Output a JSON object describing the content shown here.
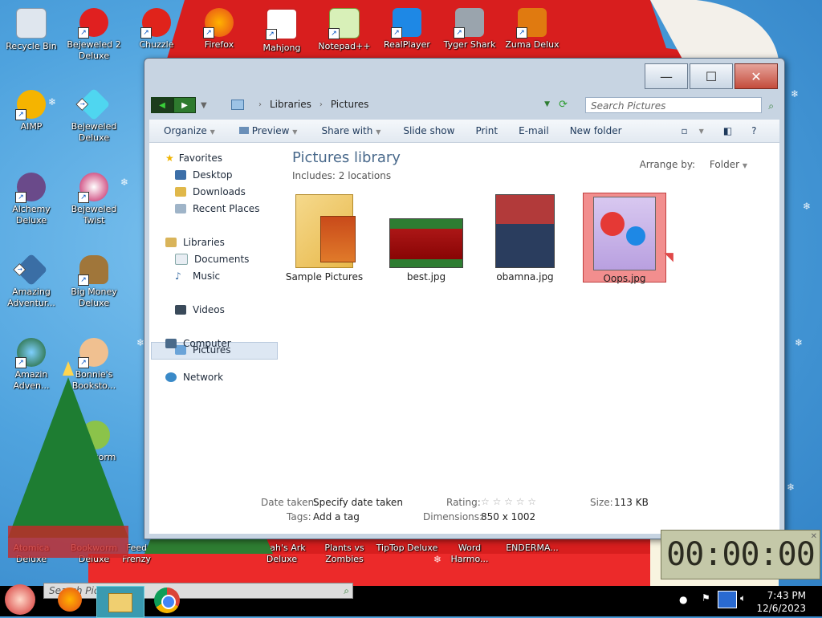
{
  "desktop_icons": [
    {
      "label": "Recycle Bin"
    },
    {
      "label": "Bejeweled 2 Deluxe"
    },
    {
      "label": "Chuzzle"
    },
    {
      "label": "Firefox"
    },
    {
      "label": "Mahjong"
    },
    {
      "label": "Notepad++"
    },
    {
      "label": "RealPlayer"
    },
    {
      "label": "Tyger Shark"
    },
    {
      "label": "Zuma Delux"
    },
    {
      "label": "AIMP"
    },
    {
      "label": "Bejeweled Deluxe"
    },
    {
      "label": "Alchemy Deluxe"
    },
    {
      "label": "Bejeweled Twist"
    },
    {
      "label": "Amazing Adventur..."
    },
    {
      "label": "Big Money Deluxe"
    },
    {
      "label": "Amazin Adven..."
    },
    {
      "label": "Bonnie's Booksto..."
    },
    {
      "label": "worm"
    },
    {
      "label": "Atomica Deluxe"
    },
    {
      "label": "Bookworm Deluxe"
    },
    {
      "label": "Feed Frenzy"
    },
    {
      "label": "ong"
    },
    {
      "label": "Noah's Ark Deluxe"
    },
    {
      "label": "Plants vs Zombies"
    },
    {
      "label": "TipTop Deluxe"
    },
    {
      "label": "Word Harmo..."
    },
    {
      "label": "ENDERMA..."
    }
  ],
  "window": {
    "breadcrumb": [
      "Libraries",
      "Pictures"
    ],
    "search_placeholder": "Search Pictures",
    "toolbar": [
      "Organize",
      "Preview",
      "Share with",
      "Slide show",
      "Print",
      "E-mail",
      "New folder"
    ],
    "nav": {
      "favorites_header": "Favorites",
      "favorites": [
        "Desktop",
        "Downloads",
        "Recent Places"
      ],
      "libraries_header": "Libraries",
      "libraries": [
        "Documents",
        "Music",
        "Pictures",
        "Videos"
      ],
      "computer": "Computer",
      "network": "Network"
    },
    "library_title": "Pictures library",
    "library_subtitle": "Includes:  2 locations",
    "arrange_label": "Arrange by:",
    "arrange_value": "Folder",
    "files": [
      {
        "name": "Sample Pictures"
      },
      {
        "name": "best.jpg"
      },
      {
        "name": "obamna.jpg"
      },
      {
        "name": "Oops.jpg"
      }
    ],
    "details": {
      "date_label": "Date taken:",
      "date_value": "Specify date taken",
      "tags_label": "Tags:",
      "tags_value": "Add a tag",
      "rating_label": "Rating:",
      "rating_stars": "☆ ☆ ☆ ☆ ☆",
      "dimensions_label": "Dimensions:",
      "dimensions_value": "850 x 1002",
      "size_label": "Size:",
      "size_value": "113 KB"
    }
  },
  "taskbar": {
    "search_placeholder": "Search Pictu",
    "time": "7:43 PM",
    "date": "12/6/2023"
  },
  "timer": {
    "display": "00:00:00"
  },
  "colors": {
    "selection": "#f28e8e",
    "accent": "#1e395b"
  }
}
